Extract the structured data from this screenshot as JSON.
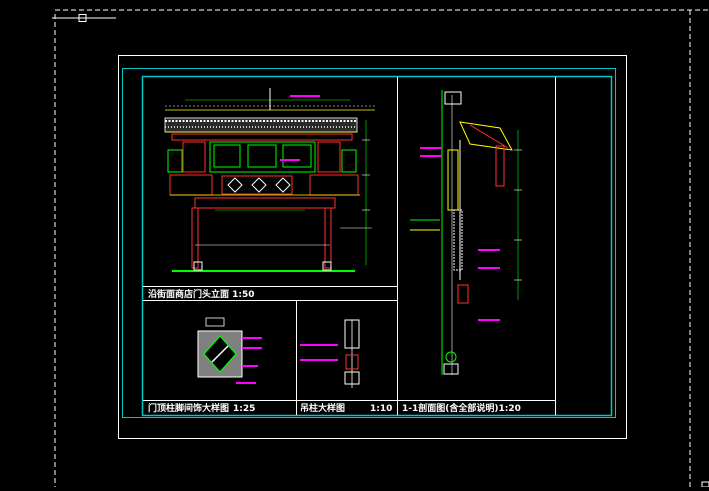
{
  "drawing": {
    "title_elevation": "沿街面商店门头立面",
    "scale_elevation": "1:50",
    "title_detail_a": "门顶柱脚间饰大样图",
    "scale_detail_a": "1:25",
    "title_detail_b": "吊柱大样图",
    "scale_detail_b": "1:10",
    "title_section": "1-1剖面图(含全部说明)",
    "scale_section": "1:20"
  },
  "colors": {
    "background": "#000000",
    "sheet_border": "#ffffff",
    "frame": "#00c8c8",
    "lines_white": "#ffffff",
    "green": "#00ff00",
    "yellow": "#ffff00",
    "red": "#ff3030",
    "magenta": "#ff00ff",
    "cyan": "#00ffff"
  }
}
